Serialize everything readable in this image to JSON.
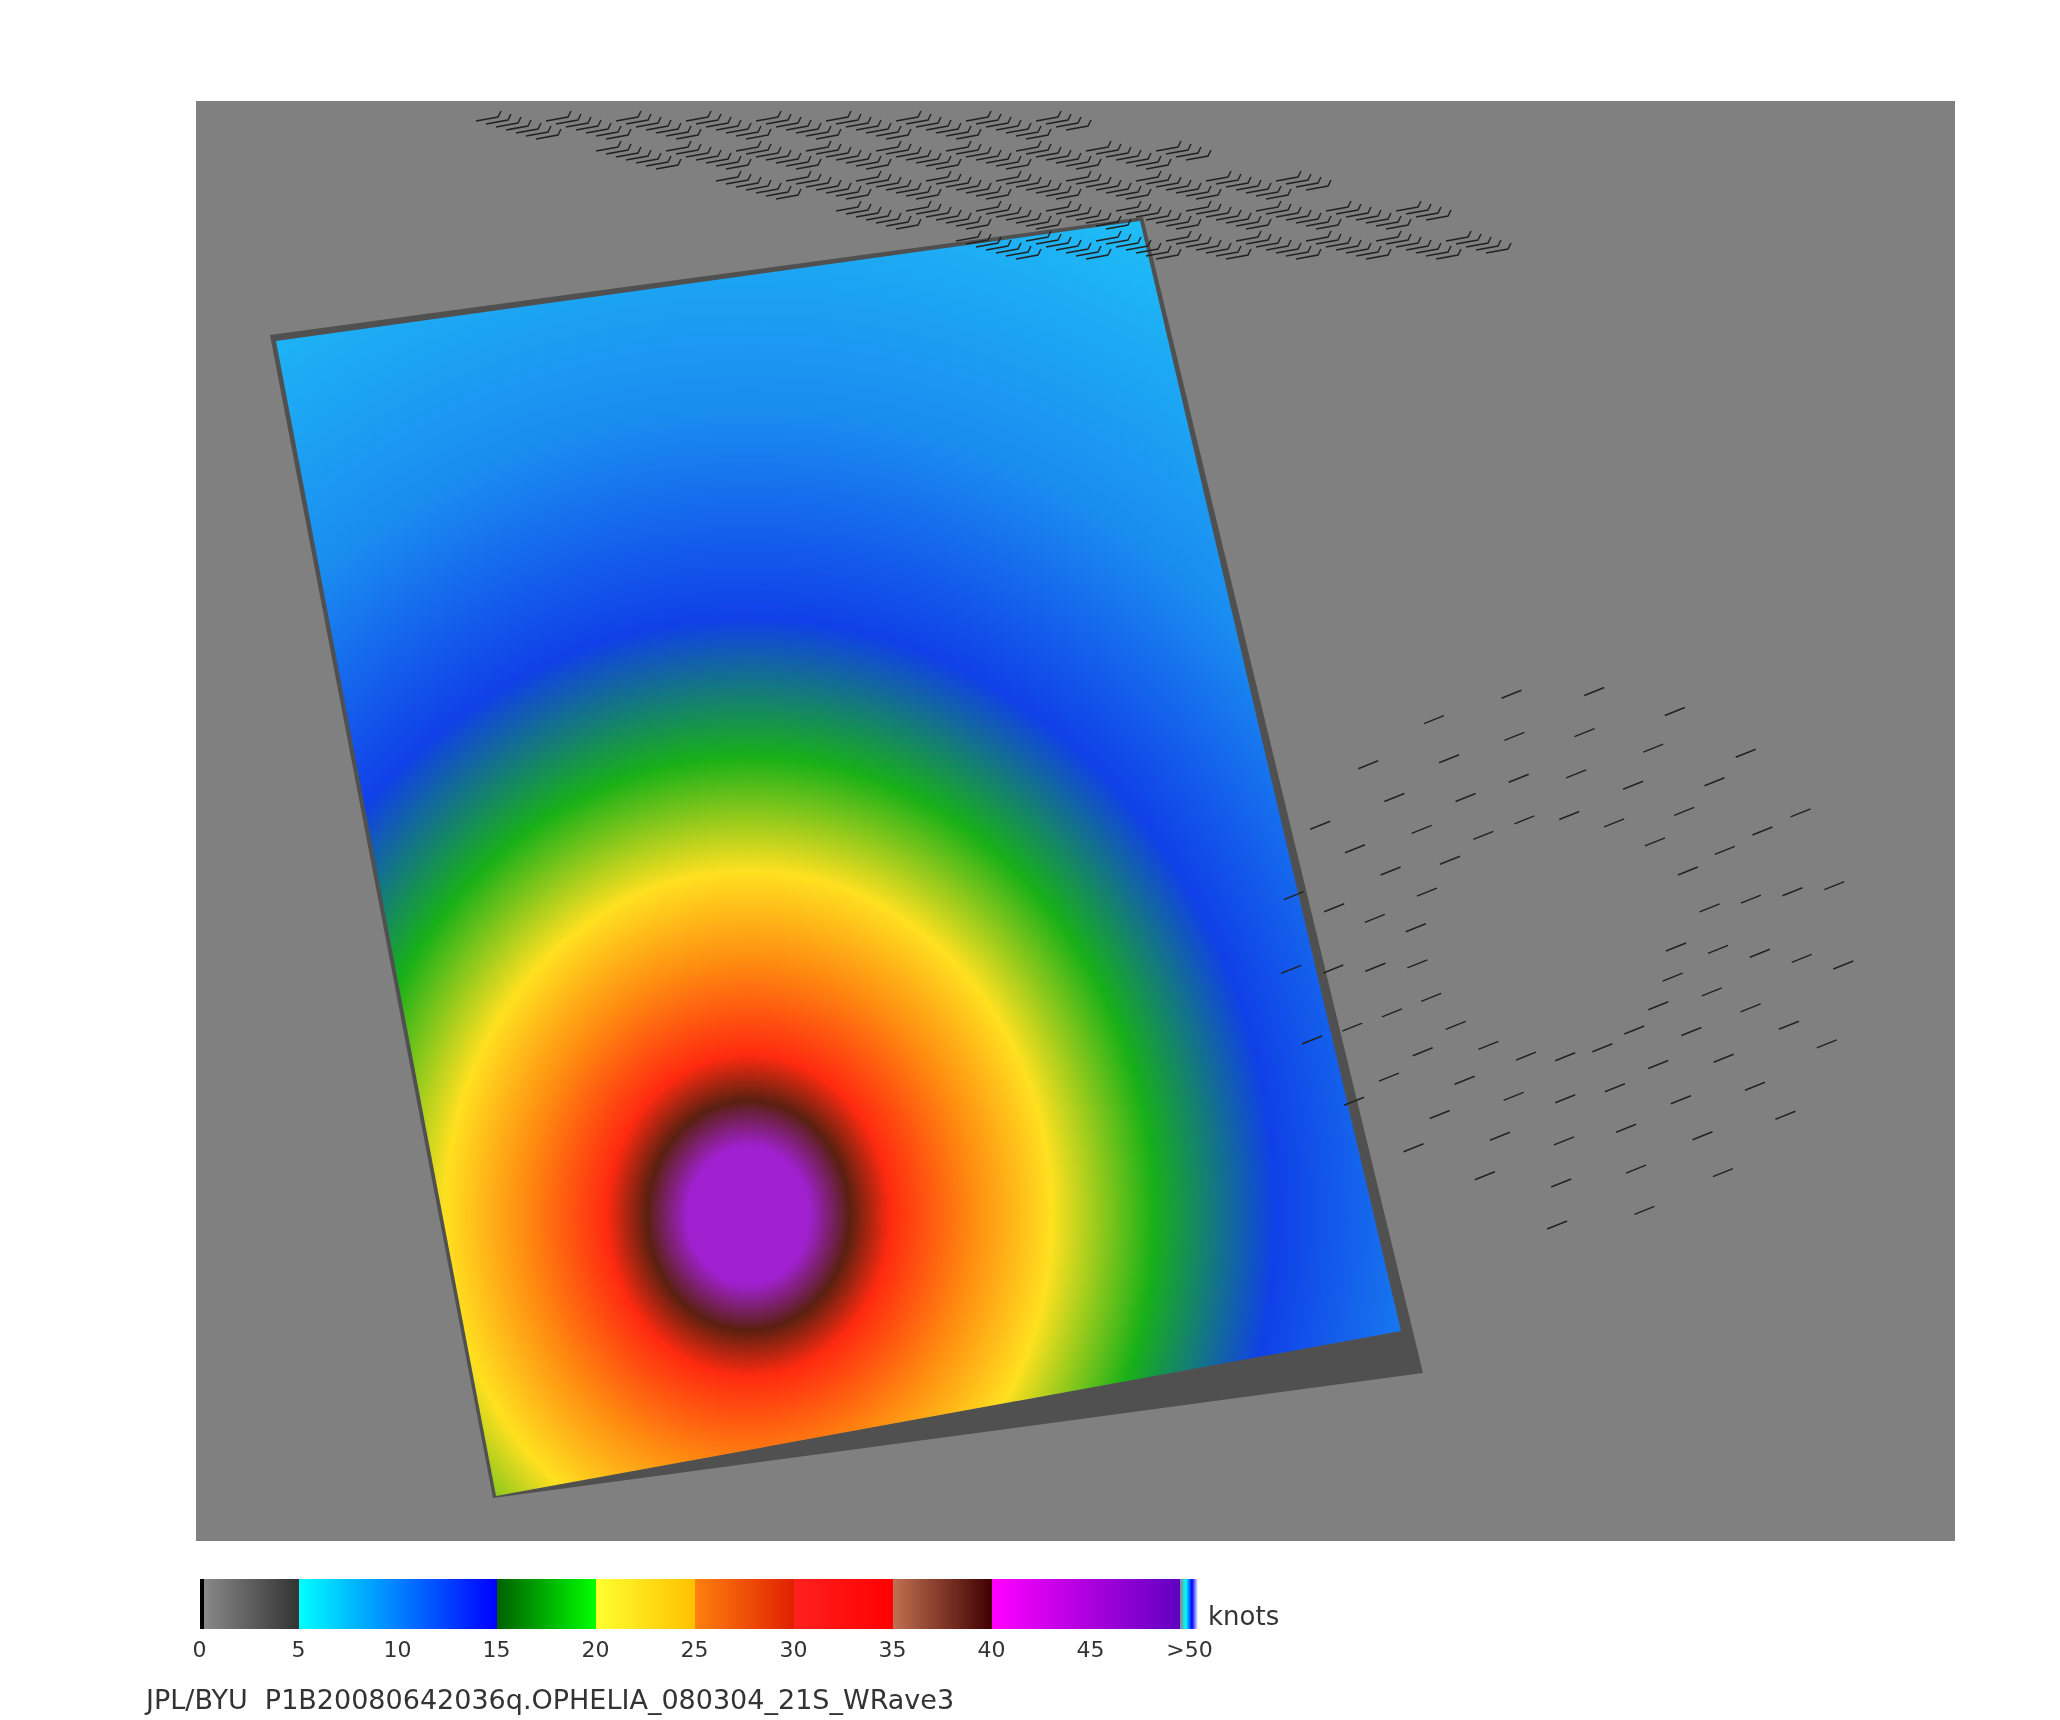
{
  "colorbar": {
    "unit": "knots",
    "ticks": [
      "0",
      "5",
      "10",
      "15",
      "20",
      "25",
      "30",
      "35",
      "40",
      "45",
      ">50"
    ]
  },
  "caption": "JPL/BYU  P1B20080642036q.OPHELIA_080304_21S_WRave3"
}
